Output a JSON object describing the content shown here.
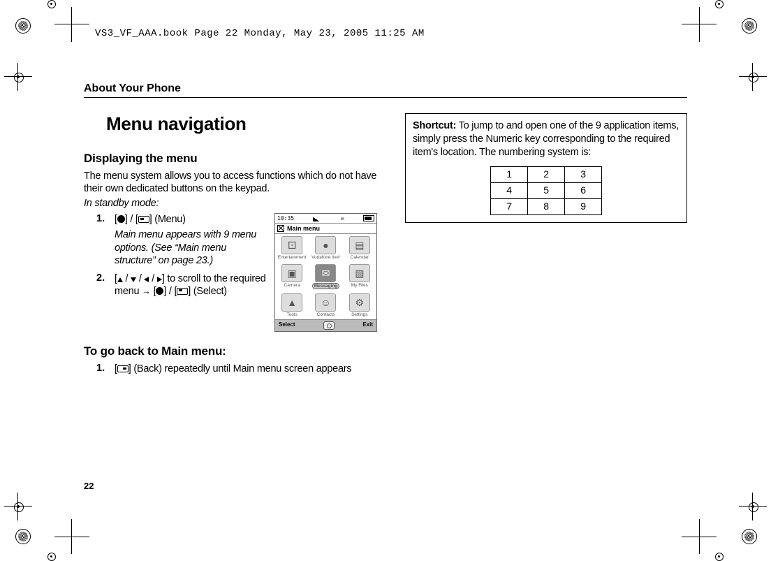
{
  "file_header": "VS3_VF_AAA.book  Page 22  Monday, May 23, 2005  11:25 AM",
  "section_header": "About Your Phone",
  "title": "Menu navigation",
  "sub1": "Displaying the menu",
  "intro": "The menu system allows you to access functions which do not have their own dedicated buttons on the keypad.",
  "standby": "In standby mode:",
  "step1_num": "1.",
  "step1_tail": " (Menu)",
  "step1_desc": "Main menu appears with 9 menu options. (See “Main menu structure” on page 23.)",
  "step2_num": "2.",
  "step2_lead": " to scroll to the required menu ",
  "step2_tail": " (Select)",
  "sub2": "To go back to Main menu:",
  "stepB_num": "1.",
  "stepB_tail": " (Back) repeatedly until Main menu screen appears",
  "phone": {
    "time": "10:35",
    "title": "Main menu",
    "cells": [
      "Entertainment",
      "Vodafone live!",
      "Calendar",
      "Camera",
      "Messaging",
      "My Files",
      "Tools",
      "Contacts",
      "Settings"
    ],
    "cell_icons": [
      "⚀",
      "●",
      "▤",
      "▣",
      "✉",
      "▧",
      "▲",
      "☺",
      "⚙"
    ],
    "soft_left": "Select",
    "soft_right": "Exit"
  },
  "shortcut_label": "Shortcut:",
  "shortcut_text": "  To jump to and open one of the 9 application items, simply press the Numeric key corresponding to the required item's location. The numbering system is:",
  "grid": [
    [
      "1",
      "2",
      "3"
    ],
    [
      "4",
      "5",
      "6"
    ],
    [
      "7",
      "8",
      "9"
    ]
  ],
  "page_number": "22"
}
